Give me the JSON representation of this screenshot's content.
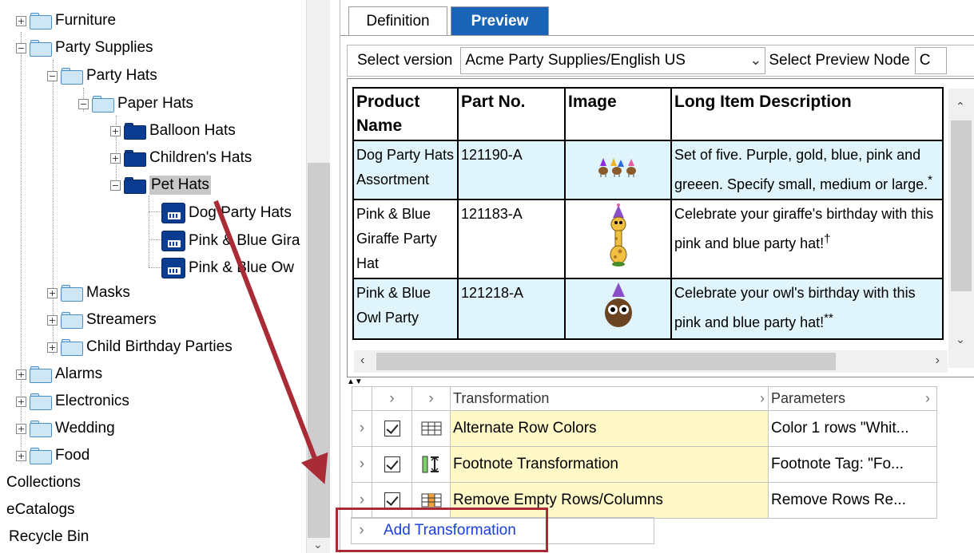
{
  "tree": {
    "items": [
      {
        "label": "Furniture",
        "expander": "+"
      },
      {
        "label": "Party Supplies",
        "expander": "−"
      },
      {
        "label": "Party Hats",
        "expander": "−"
      },
      {
        "label": "Paper Hats",
        "expander": "−"
      },
      {
        "label": "Balloon Hats",
        "expander": "+"
      },
      {
        "label": "Children's Hats",
        "expander": "+"
      },
      {
        "label": "Pet Hats",
        "expander": "−"
      },
      {
        "label": "Dog Party Hats"
      },
      {
        "label": "Pink & Blue Gira"
      },
      {
        "label": "Pink & Blue Ow"
      },
      {
        "label": "Masks",
        "expander": "+"
      },
      {
        "label": "Streamers",
        "expander": "+"
      },
      {
        "label": "Child Birthday Parties",
        "expander": "+"
      },
      {
        "label": "Alarms",
        "expander": "+"
      },
      {
        "label": "Electronics",
        "expander": "+"
      },
      {
        "label": "Wedding",
        "expander": "+"
      },
      {
        "label": "Food",
        "expander": "+"
      },
      {
        "label": "Collections"
      },
      {
        "label": "eCatalogs"
      },
      {
        "label": "Recycle Bin"
      }
    ]
  },
  "tabs": {
    "definition": "Definition",
    "preview": "Preview"
  },
  "toolbar": {
    "select_version_label": "Select version",
    "version_value": "Acme Party Supplies/English US",
    "select_node_label": "Select Preview Node",
    "node_value": "C"
  },
  "preview_table": {
    "headers": [
      "Product Name",
      "Part No.",
      "Image",
      "Long Item Description"
    ],
    "rows": [
      {
        "name": "Dog Party Hats Assortment",
        "part": "121190-A",
        "desc": "Set of five. Purple, gold, blue, pink and greeen. Specify small, medium or large.",
        "mark": "*"
      },
      {
        "name": "Pink & Blue Giraffe Party Hat",
        "part": "121183-A",
        "desc": "Celebrate your giraffe's birthday with this pink and blue party hat!",
        "mark": "†"
      },
      {
        "name": "Pink & Blue Owl Party",
        "part": "121218-A",
        "desc": "Celebrate your owl's birthday with this pink and blue party hat!",
        "mark": "**"
      }
    ]
  },
  "transformations": {
    "headers": {
      "transformation": "Transformation",
      "parameters": "Parameters"
    },
    "rows": [
      {
        "name": "Alternate Row Colors",
        "params": "Color 1 rows \"Whit..."
      },
      {
        "name": "Footnote Transformation",
        "params": "Footnote Tag: \"Fo..."
      },
      {
        "name": "Remove Empty Rows/Columns",
        "params": "Remove Rows Re..."
      }
    ],
    "add_label": "Add Transformation"
  },
  "colors": {
    "accent_tab": "#1a64b8",
    "highlight_box": "#a82b35",
    "arrow": "#a82b35",
    "alt_row": "#e0f4fb",
    "transform_name_bg": "#fff9c8"
  }
}
